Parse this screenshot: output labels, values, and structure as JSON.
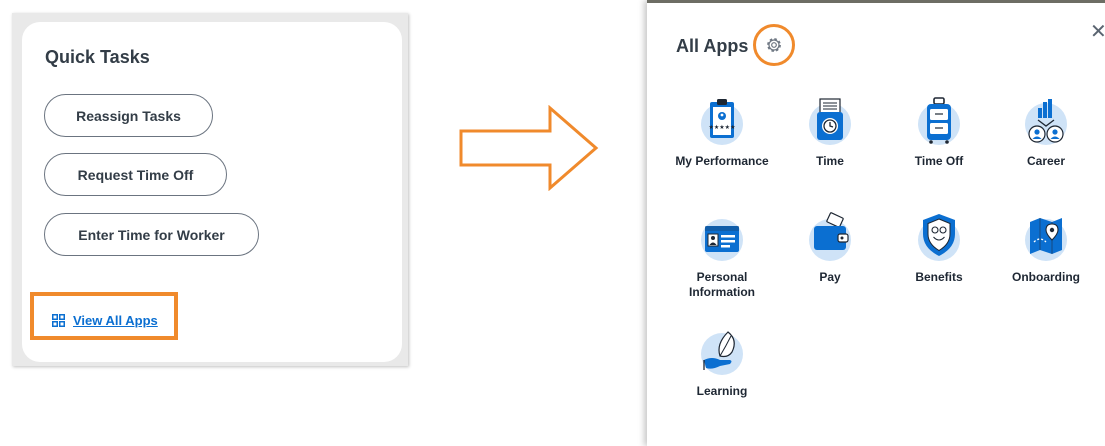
{
  "quick_tasks": {
    "title": "Quick Tasks",
    "buttons": [
      "Reassign Tasks",
      "Request Time Off",
      "Enter Time for Worker"
    ],
    "view_all_label": "View All Apps",
    "view_all_icon": "grid-icon"
  },
  "all_apps": {
    "title": "All Apps",
    "settings_icon": "gear-icon",
    "close_icon": "close-icon",
    "apps": [
      {
        "label": "My Performance",
        "icon": "clipboard-rating-icon"
      },
      {
        "label": "Time",
        "icon": "time-clock-icon"
      },
      {
        "label": "Time Off",
        "icon": "suitcase-icon"
      },
      {
        "label": "Career",
        "icon": "career-people-chart-icon"
      },
      {
        "label": "Personal Information",
        "icon": "id-card-icon"
      },
      {
        "label": "Pay",
        "icon": "wallet-icon"
      },
      {
        "label": "Benefits",
        "icon": "shield-icon"
      },
      {
        "label": "Onboarding",
        "icon": "map-icon"
      },
      {
        "label": "Learning",
        "icon": "hand-leaf-icon"
      }
    ]
  },
  "colors": {
    "highlight": "#f08a2c",
    "link": "#0b6fd1",
    "icon_primary": "#0b6fd1",
    "icon_bg": "#cfe3f7"
  }
}
